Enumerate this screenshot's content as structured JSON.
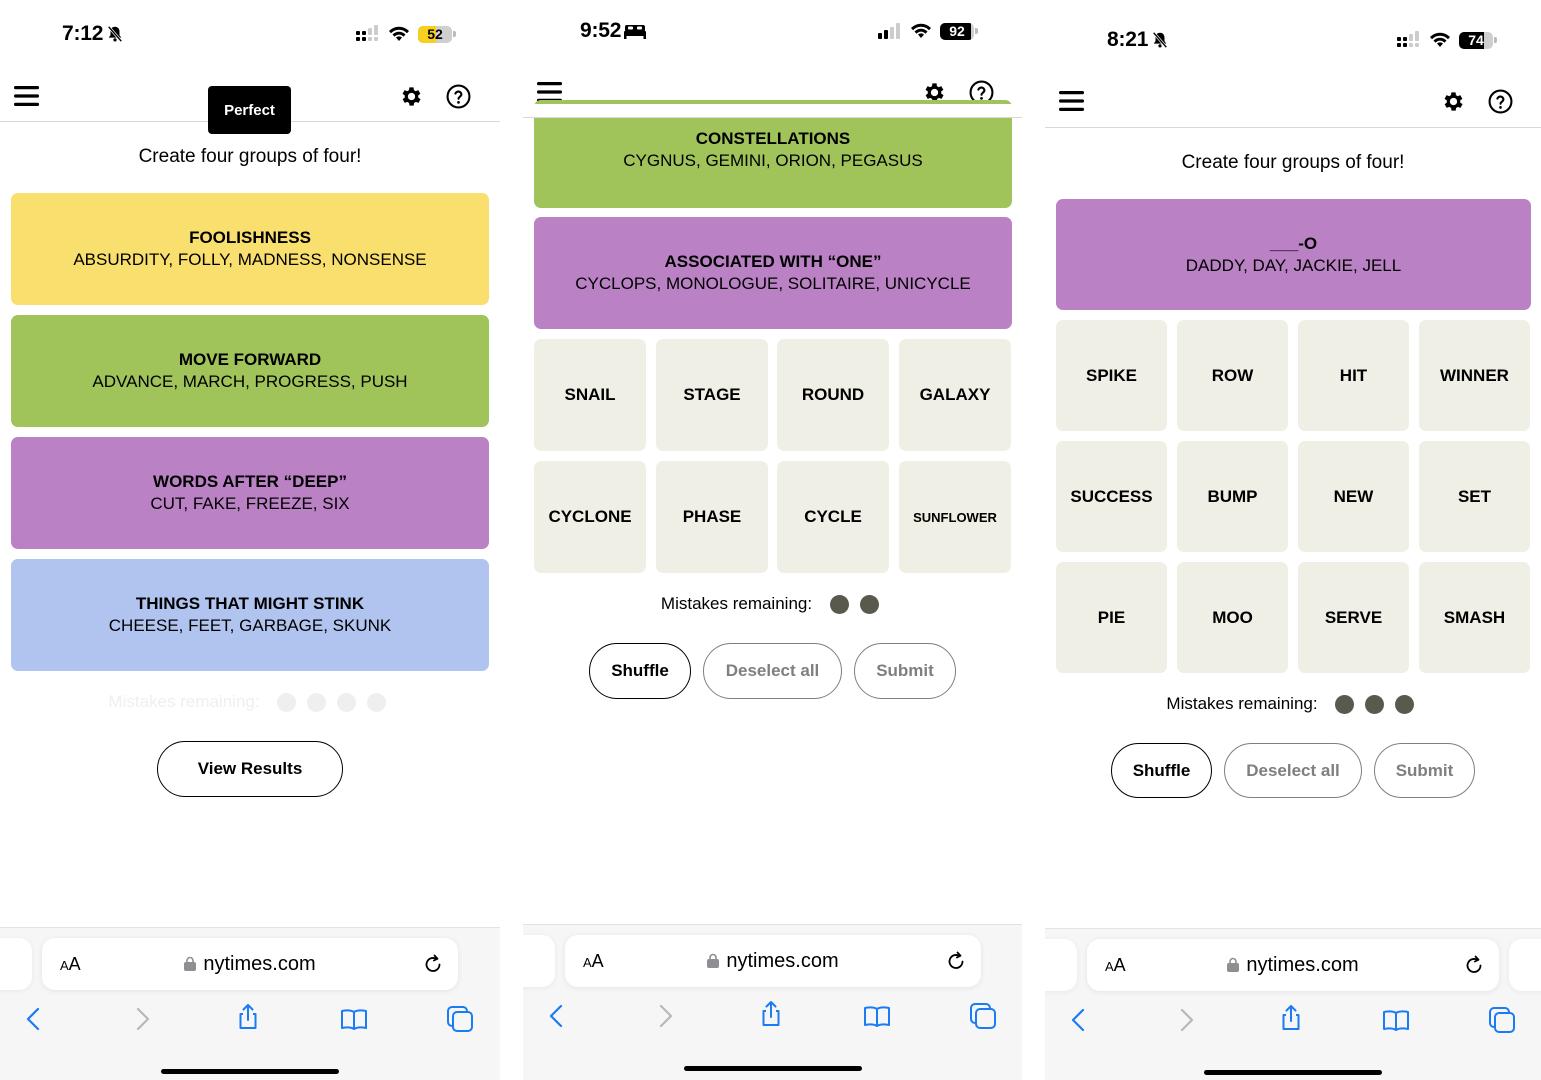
{
  "colors": {
    "yellow": "#f9df6d",
    "green": "#a0c35a",
    "blue": "#b0c4ef",
    "purple": "#ba81c5",
    "tile": "#efefe6",
    "dot": "#5a594e",
    "ios_blue": "#1a7cf5"
  },
  "panels": [
    {
      "status": {
        "time": "7:12",
        "mode_icon": "bell-slash-icon",
        "battery": "52",
        "battery_color": "#f7cf1e"
      },
      "nav": {
        "menu_icon": "hamburger-icon",
        "settings_icon": "gear-icon",
        "help_icon": "help-circle-icon"
      },
      "toast": "Perfect",
      "subtitle": "Create four groups of four!",
      "solved_groups": [
        {
          "title": "FOOLISHNESS",
          "words": "ABSURDITY, FOLLY, MADNESS, NONSENSE",
          "color": "yellow"
        },
        {
          "title": "MOVE FORWARD",
          "words": "ADVANCE, MARCH, PROGRESS, PUSH",
          "color": "green"
        },
        {
          "title": "WORDS AFTER “DEEP”",
          "words": "CUT, FAKE, FREEZE, SIX",
          "color": "purple"
        },
        {
          "title": "THINGS THAT MIGHT STINK",
          "words": "CHEESE, FEET, GARBAGE, SKUNK",
          "color": "blue"
        }
      ],
      "mistakes_label": "Mistakes remaining:",
      "mistakes_remaining": 4,
      "view_results_label": "View Results",
      "browser": {
        "aa_label": "AA",
        "url": "nytimes.com"
      }
    },
    {
      "status": {
        "time": "9:52",
        "mode_icon": "bed-icon",
        "battery": "92",
        "battery_color": "#000000"
      },
      "nav": {
        "menu_icon": "hamburger-icon",
        "settings_icon": "gear-icon",
        "help_icon": "help-circle-icon"
      },
      "solved_groups": [
        {
          "title": "CONSTELLATIONS",
          "words": "CYGNUS, GEMINI, ORION, PEGASUS",
          "color": "green"
        },
        {
          "title": "ASSOCIATED WITH “ONE”",
          "words": "CYCLOPS, MONOLOGUE, SOLITAIRE, UNICYCLE",
          "color": "purple"
        }
      ],
      "tiles": [
        "SNAIL",
        "STAGE",
        "ROUND",
        "GALAXY",
        "CYCLONE",
        "PHASE",
        "CYCLE",
        "SUNFLOWER"
      ],
      "mistakes_label": "Mistakes remaining:",
      "mistakes_remaining": 2,
      "buttons": {
        "shuffle": "Shuffle",
        "deselect": "Deselect all",
        "submit": "Submit"
      },
      "browser": {
        "aa_label": "AA",
        "url": "nytimes.com"
      }
    },
    {
      "status": {
        "time": "8:21",
        "mode_icon": "bell-slash-icon",
        "battery": "74",
        "battery_color": "#000000"
      },
      "nav": {
        "menu_icon": "hamburger-icon",
        "settings_icon": "gear-icon",
        "help_icon": "help-circle-icon"
      },
      "subtitle": "Create four groups of four!",
      "solved_groups": [
        {
          "title": "___-O",
          "words": "DADDY, DAY, JACKIE, JELL",
          "color": "purple"
        }
      ],
      "tiles": [
        "SPIKE",
        "ROW",
        "HIT",
        "WINNER",
        "SUCCESS",
        "BUMP",
        "NEW",
        "SET",
        "PIE",
        "MOO",
        "SERVE",
        "SMASH"
      ],
      "mistakes_label": "Mistakes remaining:",
      "mistakes_remaining": 3,
      "buttons": {
        "shuffle": "Shuffle",
        "deselect": "Deselect all",
        "submit": "Submit"
      },
      "browser": {
        "aa_label": "AA",
        "url": "nytimes.com"
      }
    }
  ]
}
